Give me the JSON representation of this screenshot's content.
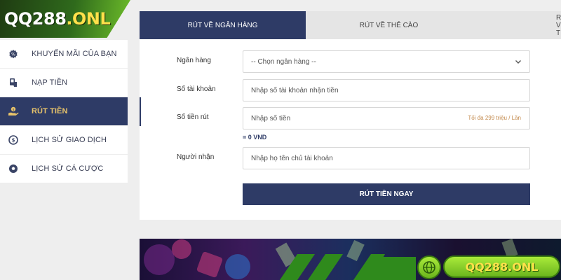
{
  "brand": {
    "logo_main": "QQ288",
    "logo_suffix": ".ONL"
  },
  "sidebar": {
    "items": [
      {
        "label": "Khuyến mãi của bạn",
        "icon": "promotion-icon",
        "active": false
      },
      {
        "label": "Nạp tiền",
        "icon": "deposit-icon",
        "active": false
      },
      {
        "label": "Rút tiền",
        "icon": "withdraw-icon",
        "active": true
      },
      {
        "label": "Lịch sử giao dịch",
        "icon": "transaction-history-icon",
        "active": false
      },
      {
        "label": "Lịch sử cá cược",
        "icon": "betting-history-icon",
        "active": false
      }
    ]
  },
  "tabs": [
    {
      "label": "Rút về ngân hàng",
      "active": true
    },
    {
      "label": "Rút về thẻ cào",
      "active": false
    },
    {
      "label": "Rút về ti",
      "active": false
    }
  ],
  "form": {
    "bank": {
      "label": "Ngân hàng",
      "value": "-- Chọn ngân hàng --"
    },
    "account_number": {
      "label": "Số tài khoản",
      "placeholder": "Nhập số tài khoản nhận tiền"
    },
    "amount": {
      "label": "Số tiền rút",
      "placeholder": "Nhập số tiền",
      "hint": "Tối đa 299 triệu / Lần"
    },
    "amount_converted": "= 0 VND",
    "recipient": {
      "label": "Người nhận",
      "placeholder": "Nhập họ tên chủ tài khoản"
    },
    "submit_label": "Rút tiền ngay"
  },
  "banner": {
    "logo_text": "QQ288.ONL"
  },
  "colors": {
    "primary": "#2e3b66",
    "active_text": "#e9c46a",
    "hint": "#c2884a",
    "brand_green": "#6bb51d",
    "brand_yellow": "#ffe14a"
  }
}
